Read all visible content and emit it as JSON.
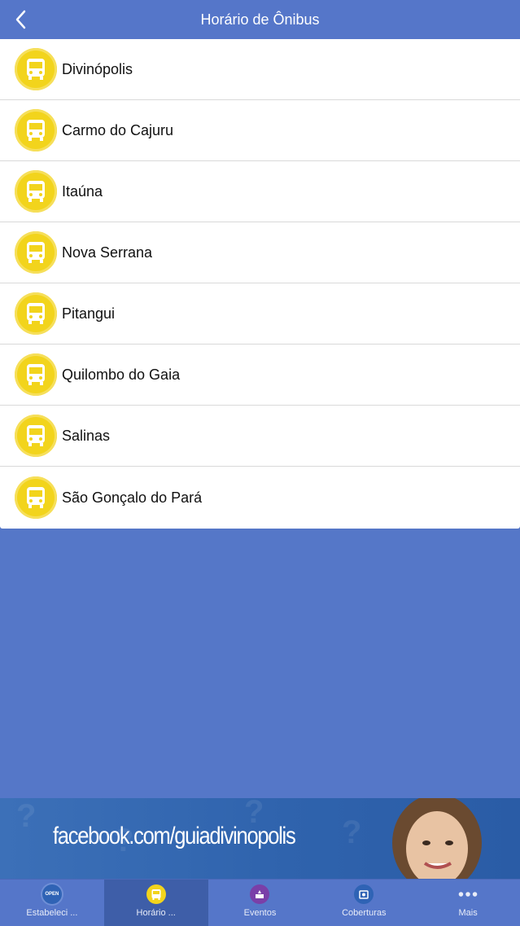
{
  "header": {
    "title": "Horário de Ônibus",
    "back_icon": "chevron-left-icon"
  },
  "cities": [
    {
      "label": "Divinópolis"
    },
    {
      "label": "Carmo do Cajuru"
    },
    {
      "label": "Itaúna"
    },
    {
      "label": "Nova Serrana"
    },
    {
      "label": "Pitangui"
    },
    {
      "label": "Quilombo do Gaia"
    },
    {
      "label": "Salinas"
    },
    {
      "label": "São Gonçalo do Pará"
    }
  ],
  "banner": {
    "text": "facebook.com/guiadivinopolis"
  },
  "tabs": [
    {
      "label": "Estabeleci ...",
      "icon": "open-sign-icon",
      "color": "#2f63b5"
    },
    {
      "label": "Horário ...",
      "icon": "bus-icon",
      "color": "#f2d41c"
    },
    {
      "label": "Eventos",
      "icon": "event-icon",
      "color": "#7a3fa8"
    },
    {
      "label": "Coberturas",
      "icon": "camera-icon",
      "color": "#2f63b5"
    },
    {
      "label": "Mais",
      "icon": "more-icon",
      "color": ""
    }
  ],
  "colors": {
    "navbar": "#5576c9",
    "background": "#5577c8",
    "icon_yellow": "#f2d41c"
  }
}
